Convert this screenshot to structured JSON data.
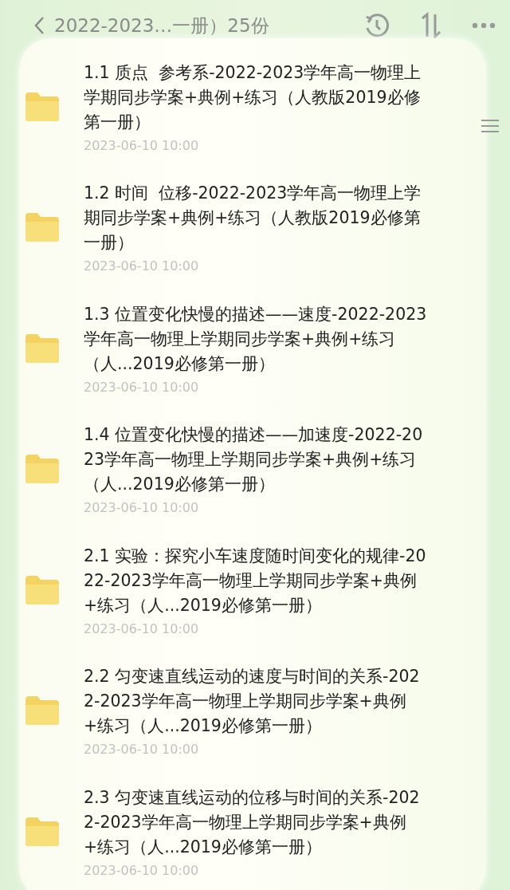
{
  "header": {
    "title": "2022-2023…一册）25份"
  },
  "files": [
    {
      "name": "1.1 质点  参考系-2022-2023学年高一物理上学期同步学案+典例+练习（人教版2019必修第一册）",
      "date": "2023-06-10 10:00"
    },
    {
      "name": "1.2 时间  位移-2022-2023学年高一物理上学期同步学案+典例+练习（人教版2019必修第一册）",
      "date": "2023-06-10 10:00"
    },
    {
      "name": "1.3 位置变化快慢的描述——速度-2022-2023学年高一物理上学期同步学案+典例+练习（人...2019必修第一册）",
      "date": "2023-06-10 10:00"
    },
    {
      "name": "1.4 位置变化快慢的描述——加速度-2022-2023学年高一物理上学期同步学案+典例+练习（人...2019必修第一册）",
      "date": "2023-06-10 10:00"
    },
    {
      "name": "2.1 实验：探究小车速度随时间变化的规律-2022-2023学年高一物理上学期同步学案+典例+练习（人...2019必修第一册）",
      "date": "2023-06-10 10:00"
    },
    {
      "name": "2.2 匀变速直线运动的速度与时间的关系-2022-2023学年高一物理上学期同步学案+典例+练习（人...2019必修第一册）",
      "date": "2023-06-10 10:00"
    },
    {
      "name": "2.3 匀变速直线运动的位移与时间的关系-2022-2023学年高一物理上学期同步学案+典例+练习（人...2019必修第一册）",
      "date": "2023-06-10 10:00"
    }
  ]
}
